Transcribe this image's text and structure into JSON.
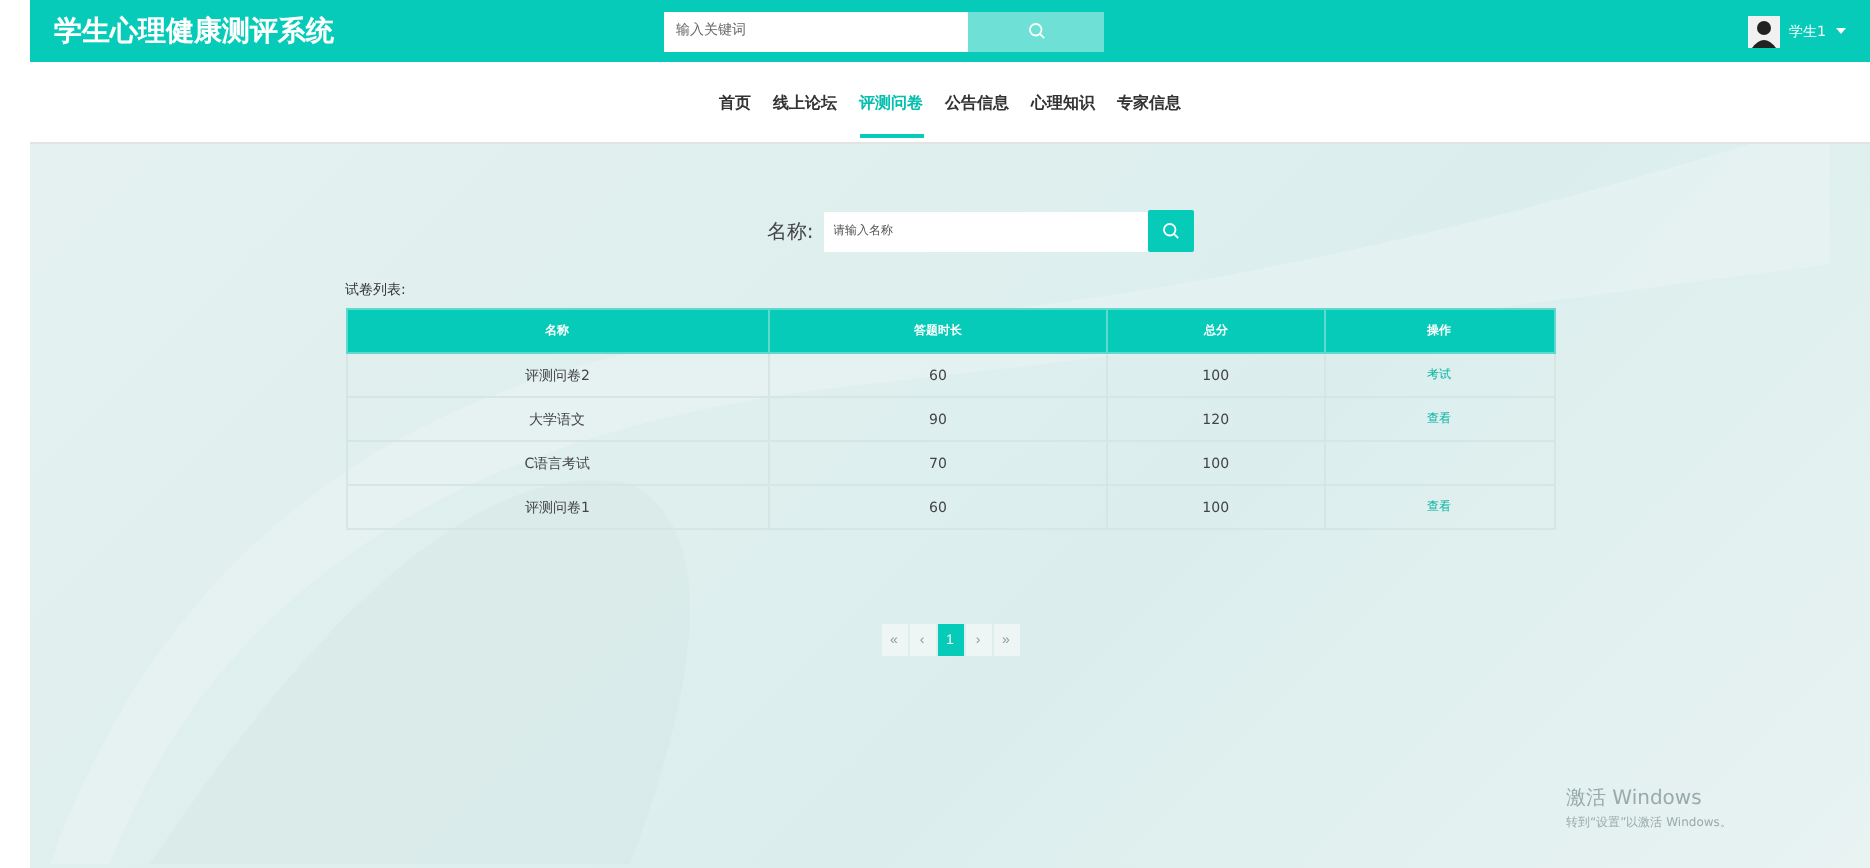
{
  "header": {
    "title": "学生心理健康测评系统",
    "search": {
      "placeholder": "输入关键词"
    },
    "user": "学生1"
  },
  "nav": [
    {
      "label": "首页",
      "selected": false
    },
    {
      "label": "线上论坛",
      "selected": false
    },
    {
      "label": "评测问卷",
      "selected": true
    },
    {
      "label": "公告信息",
      "selected": false
    },
    {
      "label": "心理知识",
      "selected": false
    },
    {
      "label": "专家信息",
      "selected": false
    }
  ],
  "filter": {
    "label": "名称:",
    "placeholder": "请输入名称"
  },
  "table": {
    "caption": "试卷列表:",
    "columns": [
      "名称",
      "答题时长",
      "总分",
      "操作"
    ],
    "rows": [
      {
        "cells": [
          "评测问卷2",
          "60",
          "100"
        ],
        "action": "考试"
      },
      {
        "cells": [
          "大学语文",
          "90",
          "120"
        ],
        "action": "查看"
      },
      {
        "cells": [
          "C语言考试",
          "70",
          "100"
        ]
      },
      {
        "cells": [
          "评测问卷1",
          "60",
          "100"
        ],
        "action": "查看"
      }
    ]
  },
  "pagination": [
    {
      "label": "«",
      "selected": false
    },
    {
      "label": "‹",
      "selected": false
    },
    {
      "label": "1",
      "selected": true
    },
    {
      "label": "›",
      "selected": false
    },
    {
      "label": "»",
      "selected": false
    }
  ],
  "os_notice": {
    "title": "激活 Windows",
    "text": "转到“设置”以激活 Windows。"
  }
}
